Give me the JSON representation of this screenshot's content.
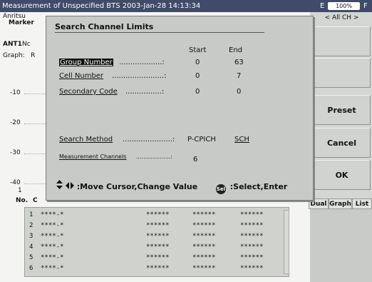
{
  "topbar": {
    "title": "Measurement of Unspecified BTS  2003-Jan-28 14:13:34",
    "status_e": "E",
    "battery": "100%",
    "status_f": "F"
  },
  "left_panel": {
    "brand": "Anritsu",
    "marker": "Marker",
    "antenna": "ANT1",
    "antenna_suffix": "Nc",
    "graph_label": "Graph:",
    "graph_suffix": "R",
    "axis": [
      "-10",
      "-20",
      "-30",
      "-40"
    ],
    "axis_bottom": "1",
    "table_header_no": "No.",
    "table_header_c": "C"
  },
  "softkeys": {
    "channel_select": "< All CH >",
    "preset": "Preset",
    "cancel": "Cancel",
    "ok": "OK"
  },
  "tabs": [
    "Dual",
    "Graph",
    "List"
  ],
  "table": {
    "rows": [
      {
        "no": "1",
        "code": "****-*",
        "c1": "******",
        "c2": "******",
        "c3": "******"
      },
      {
        "no": "2",
        "code": "****-*",
        "c1": "******",
        "c2": "******",
        "c3": "******"
      },
      {
        "no": "3",
        "code": "****-*",
        "c1": "******",
        "c2": "******",
        "c3": "******"
      },
      {
        "no": "4",
        "code": "****-*",
        "c1": "******",
        "c2": "******",
        "c3": "******"
      },
      {
        "no": "5",
        "code": "****-*",
        "c1": "******",
        "c2": "******",
        "c3": "******"
      },
      {
        "no": "6",
        "code": "****-*",
        "c1": "******",
        "c2": "******",
        "c3": "******"
      }
    ]
  },
  "dialog": {
    "title": "Search Channel Limits",
    "col_start": "Start",
    "col_end": "End",
    "group_number": {
      "label": "Group Number",
      "start": "0",
      "end": "63"
    },
    "cell_number": {
      "label": "Cell Number",
      "start": "0",
      "end": "7"
    },
    "secondary_code": {
      "label": "Secondary Code",
      "start": "0",
      "end": "0"
    },
    "search_method": {
      "label": "Search Method",
      "option1": "P-CPICH",
      "option2": "SCH"
    },
    "measurement_channels": {
      "label": "Measurement Channels",
      "value": "6"
    },
    "help_move": "Move Cursor,Change Value",
    "help_select": "Select,Enter",
    "sel_icon_text": "Sel"
  }
}
